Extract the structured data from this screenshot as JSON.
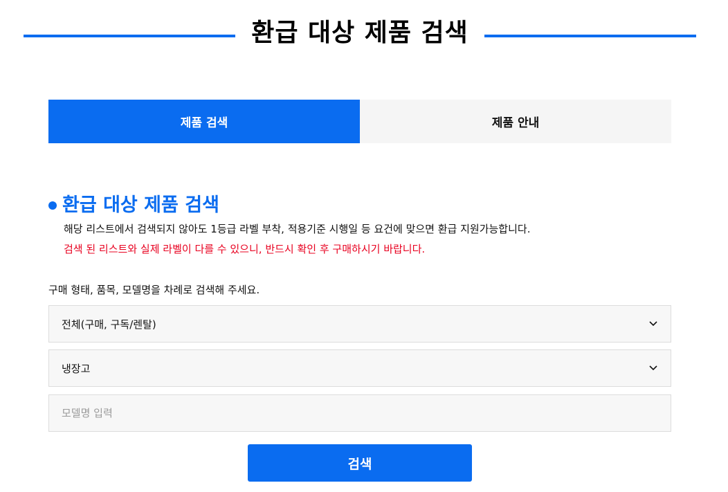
{
  "header": {
    "title": "환급 대상 제품 검색",
    "accent_color": "#0a6cf0"
  },
  "tabs": [
    {
      "label": "제품 검색",
      "active": true
    },
    {
      "label": "제품 안내",
      "active": false
    }
  ],
  "section": {
    "title": "환급 대상 제품 검색",
    "description": "해당 리스트에서 검색되지 않아도 1등급 라벨 부착, 적용기준 시행일 등 요건에 맞으면 환급 지원가능합니다.",
    "warning": "검색 된 리스트와 실제 라벨이 다를 수 있으니, 반드시 확인 후 구매하시기 바랍니다.",
    "warning_color": "#e8001f"
  },
  "form": {
    "instruction": "구매 형태, 품목, 모델명을 차례로 검색해 주세요.",
    "purchase_type": {
      "selected": "전체(구매, 구독/렌탈)",
      "icon": "chevron-down-icon"
    },
    "product_category": {
      "selected": "냉장고",
      "icon": "chevron-down-icon"
    },
    "model": {
      "value": "",
      "placeholder": "모델명 입력"
    },
    "search_label": "검색"
  }
}
